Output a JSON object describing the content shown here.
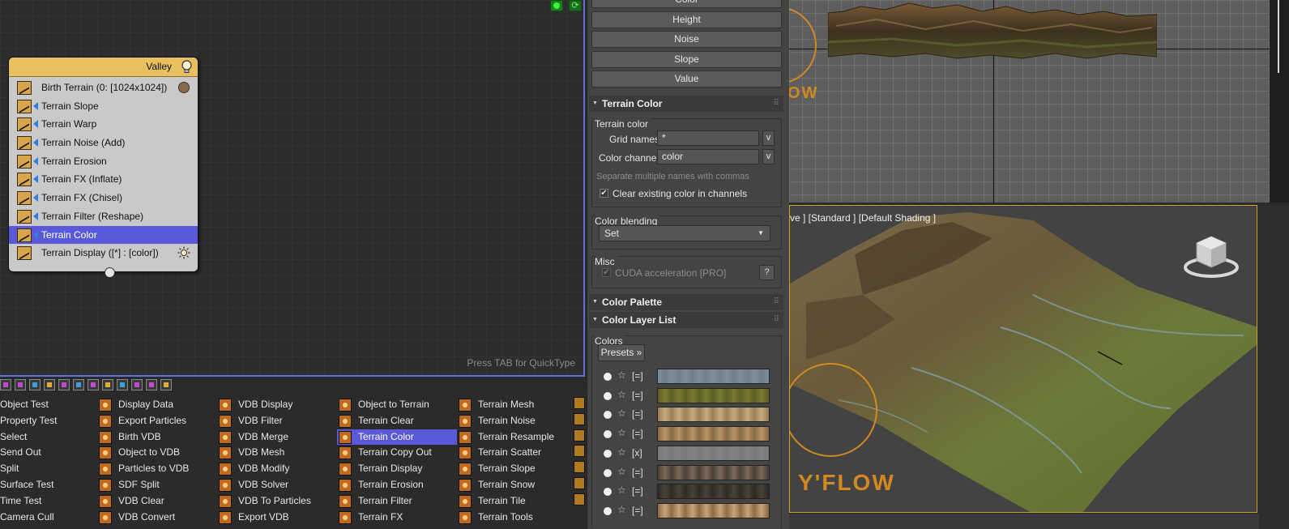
{
  "node_editor": {
    "quicktype_hint": "Press TAB for QuickType",
    "node": {
      "title": "Valley",
      "operators": [
        {
          "label": "Birth Terrain (0: [1024x1024])"
        },
        {
          "label": "Terrain Slope"
        },
        {
          "label": "Terrain Warp"
        },
        {
          "label": "Terrain Noise (Add)"
        },
        {
          "label": "Terrain Erosion"
        },
        {
          "label": "Terrain FX (Inflate)"
        },
        {
          "label": "Terrain FX (Chisel)"
        },
        {
          "label": "Terrain Filter (Reshape)"
        },
        {
          "label": "Terrain Color",
          "selected": true
        },
        {
          "label": "Terrain Display ([*] : [color])"
        }
      ]
    }
  },
  "palette": {
    "columns": [
      [
        "Object Test",
        "Property Test",
        "Select",
        "Send Out",
        "Split",
        "Surface Test",
        "Time Test",
        "Camera Cull"
      ],
      [
        "Display Data",
        "Export Particles",
        "Birth VDB",
        "Object to VDB",
        "Particles to VDB",
        "SDF Split",
        "VDB Clear",
        "VDB Convert"
      ],
      [
        "VDB Display",
        "VDB Filter",
        "VDB Merge",
        "VDB Mesh",
        "VDB Modify",
        "VDB Solver",
        "VDB To Particles",
        "Export VDB"
      ],
      [
        "Object to Terrain",
        "Terrain Clear",
        "Terrain Color",
        "Terrain Copy Out",
        "Terrain Display",
        "Terrain Erosion",
        "Terrain Filter",
        "Terrain FX"
      ],
      [
        "Terrain Mesh",
        "Terrain Noise",
        "Terrain Resample",
        "Terrain Scatter",
        "Terrain Slope",
        "Terrain Snow",
        "Terrain Tile",
        "Terrain Tools"
      ]
    ],
    "selected": "Terrain Color"
  },
  "rollout": {
    "channel_buttons": [
      "Color",
      "Height",
      "Noise",
      "Slope",
      "Value"
    ],
    "terrain_color": {
      "header": "Terrain Color",
      "group_title": "Terrain color",
      "grid_names_label": "Grid names:",
      "grid_names_value": "*",
      "color_channel_label": "Color channel:",
      "color_channel_value": "color",
      "v_label": "v",
      "hint": "Separate multiple names with commas",
      "clear_checkbox_label": "Clear existing color in channels",
      "blending_title": "Color blending",
      "blending_value": "Set",
      "misc_title": "Misc",
      "cuda_label": "CUDA acceleration [PRO]",
      "help_label": "?"
    },
    "color_palette": {
      "header": "Color Palette"
    },
    "color_layer_list": {
      "header": "Color Layer List",
      "colors_title": "Colors",
      "presets_label": "Presets »",
      "layers": [
        {
          "mode": "[=]",
          "c1": "#7f8e99",
          "c2": "#6f7f8a"
        },
        {
          "mode": "[=]",
          "c1": "#5e5f24",
          "c2": "#7a7a33"
        },
        {
          "mode": "[=]",
          "c1": "#9a7f5a",
          "c2": "#c8a97a"
        },
        {
          "mode": "[=]",
          "c1": "#8a6a44",
          "c2": "#b89466"
        },
        {
          "mode": "[x]",
          "c1": "#7a7a7a",
          "c2": "#838383"
        },
        {
          "mode": "[=]",
          "c1": "#4a4036",
          "c2": "#7a6a5a"
        },
        {
          "mode": "[=]",
          "c1": "#2e2a24",
          "c2": "#4a4236"
        },
        {
          "mode": "[=]",
          "c1": "#8f6a44",
          "c2": "#c8a27a"
        }
      ]
    }
  },
  "viewport": {
    "top_logo_text": "OW",
    "persp_label": "ve ] [Standard ] [Default Shading ]",
    "persp_logo_text": "Y'FLOW",
    "accent": "#d08a20"
  }
}
